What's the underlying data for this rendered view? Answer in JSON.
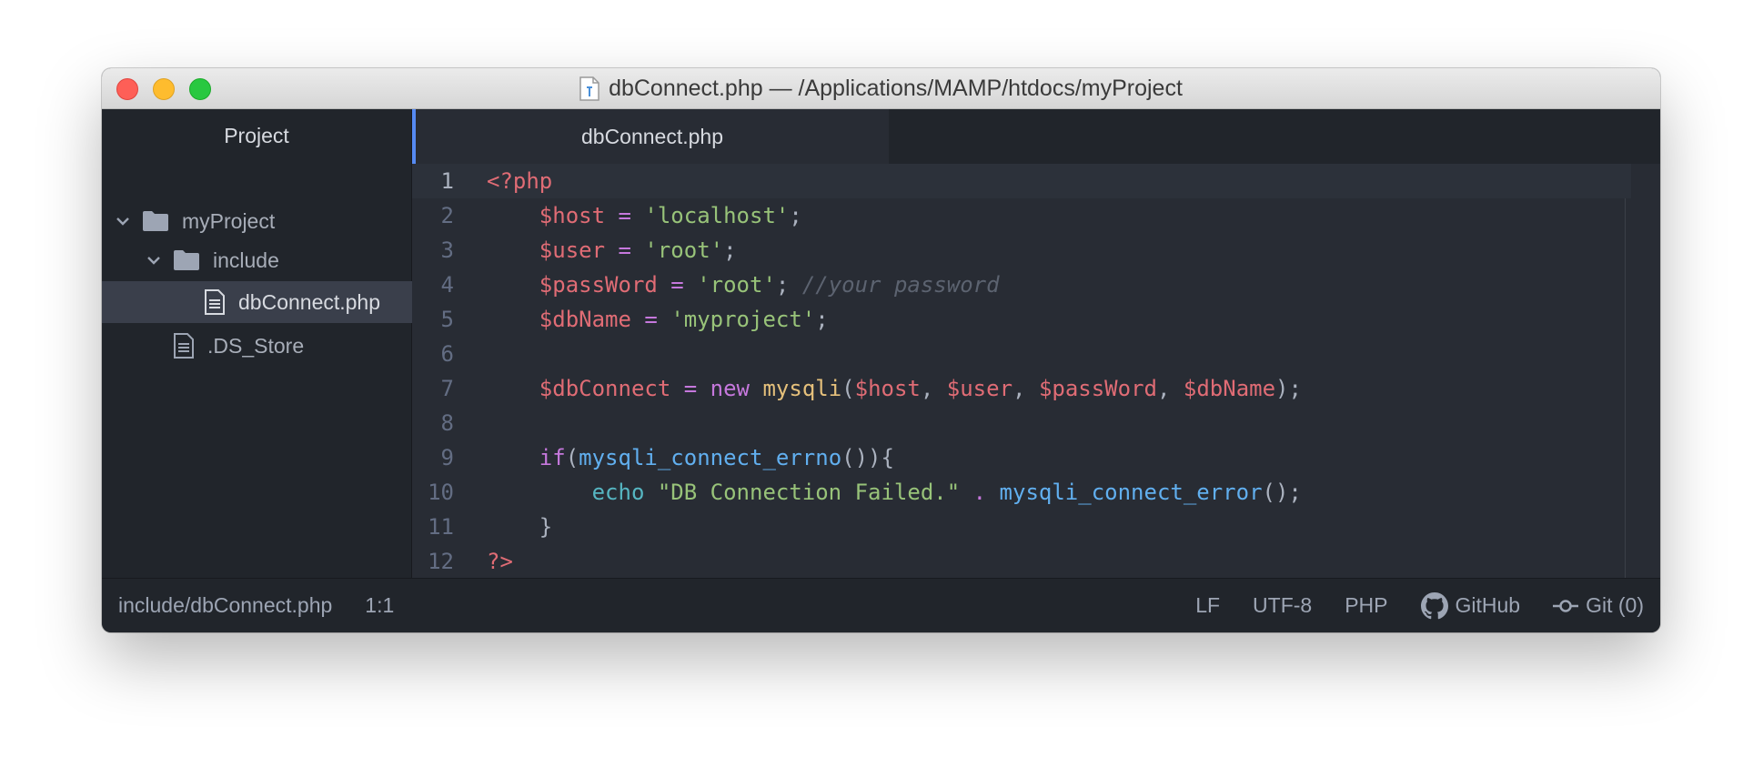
{
  "window": {
    "title": "dbConnect.php — /Applications/MAMP/htdocs/myProject",
    "title_icon": "php-file-icon"
  },
  "sidebar": {
    "header": "Project",
    "tree": [
      {
        "label": "myProject",
        "kind": "folder",
        "expanded": true,
        "depth": 0
      },
      {
        "label": "include",
        "kind": "folder",
        "expanded": true,
        "depth": 1
      },
      {
        "label": "dbConnect.php",
        "kind": "file",
        "selected": true,
        "depth": 2
      },
      {
        "label": ".DS_Store",
        "kind": "file",
        "depth": 1
      }
    ]
  },
  "tabs": [
    {
      "label": "dbConnect.php",
      "active": true
    }
  ],
  "code": {
    "lines": [
      [
        {
          "t": "<?php",
          "c": "tag"
        }
      ],
      [
        {
          "t": "    ",
          "c": "punct"
        },
        {
          "t": "$host",
          "c": "var"
        },
        {
          "t": " = ",
          "c": "op"
        },
        {
          "t": "'localhost'",
          "c": "str"
        },
        {
          "t": ";",
          "c": "punct"
        }
      ],
      [
        {
          "t": "    ",
          "c": "punct"
        },
        {
          "t": "$user",
          "c": "var"
        },
        {
          "t": " = ",
          "c": "op"
        },
        {
          "t": "'root'",
          "c": "str"
        },
        {
          "t": ";",
          "c": "punct"
        }
      ],
      [
        {
          "t": "    ",
          "c": "punct"
        },
        {
          "t": "$passWord",
          "c": "var"
        },
        {
          "t": " = ",
          "c": "op"
        },
        {
          "t": "'root'",
          "c": "str"
        },
        {
          "t": "; ",
          "c": "punct"
        },
        {
          "t": "//your password",
          "c": "comment"
        }
      ],
      [
        {
          "t": "    ",
          "c": "punct"
        },
        {
          "t": "$dbName",
          "c": "var"
        },
        {
          "t": " = ",
          "c": "op"
        },
        {
          "t": "'myproject'",
          "c": "str"
        },
        {
          "t": ";",
          "c": "punct"
        }
      ],
      [],
      [
        {
          "t": "    ",
          "c": "punct"
        },
        {
          "t": "$dbConnect",
          "c": "var"
        },
        {
          "t": " = ",
          "c": "op"
        },
        {
          "t": "new",
          "c": "kw"
        },
        {
          "t": " ",
          "c": "punct"
        },
        {
          "t": "mysqli",
          "c": "class"
        },
        {
          "t": "(",
          "c": "punct"
        },
        {
          "t": "$host",
          "c": "var"
        },
        {
          "t": ", ",
          "c": "punct"
        },
        {
          "t": "$user",
          "c": "var"
        },
        {
          "t": ", ",
          "c": "punct"
        },
        {
          "t": "$passWord",
          "c": "var"
        },
        {
          "t": ", ",
          "c": "punct"
        },
        {
          "t": "$dbName",
          "c": "var"
        },
        {
          "t": ");",
          "c": "punct"
        }
      ],
      [],
      [
        {
          "t": "    ",
          "c": "punct"
        },
        {
          "t": "if",
          "c": "kw"
        },
        {
          "t": "(",
          "c": "punct"
        },
        {
          "t": "mysqli_connect_errno",
          "c": "fn"
        },
        {
          "t": "()){",
          "c": "punct"
        }
      ],
      [
        {
          "t": "        ",
          "c": "punct"
        },
        {
          "t": "echo",
          "c": "builtin"
        },
        {
          "t": " ",
          "c": "punct"
        },
        {
          "t": "\"DB Connection Failed.\"",
          "c": "str"
        },
        {
          "t": " ",
          "c": "punct"
        },
        {
          "t": ".",
          "c": "op"
        },
        {
          "t": " ",
          "c": "punct"
        },
        {
          "t": "mysqli_connect_error",
          "c": "fn"
        },
        {
          "t": "();",
          "c": "punct"
        }
      ],
      [
        {
          "t": "    }",
          "c": "punct"
        }
      ],
      [
        {
          "t": "?>",
          "c": "tag"
        }
      ]
    ]
  },
  "status": {
    "path": "include/dbConnect.php",
    "cursor": "1:1",
    "line_ending": "LF",
    "encoding": "UTF-8",
    "grammar": "PHP",
    "github": "GitHub",
    "git": "Git (0)"
  },
  "colors": {
    "accent": "#568af2",
    "editor_bg": "#282c34",
    "sidebar_bg": "#21252b"
  }
}
